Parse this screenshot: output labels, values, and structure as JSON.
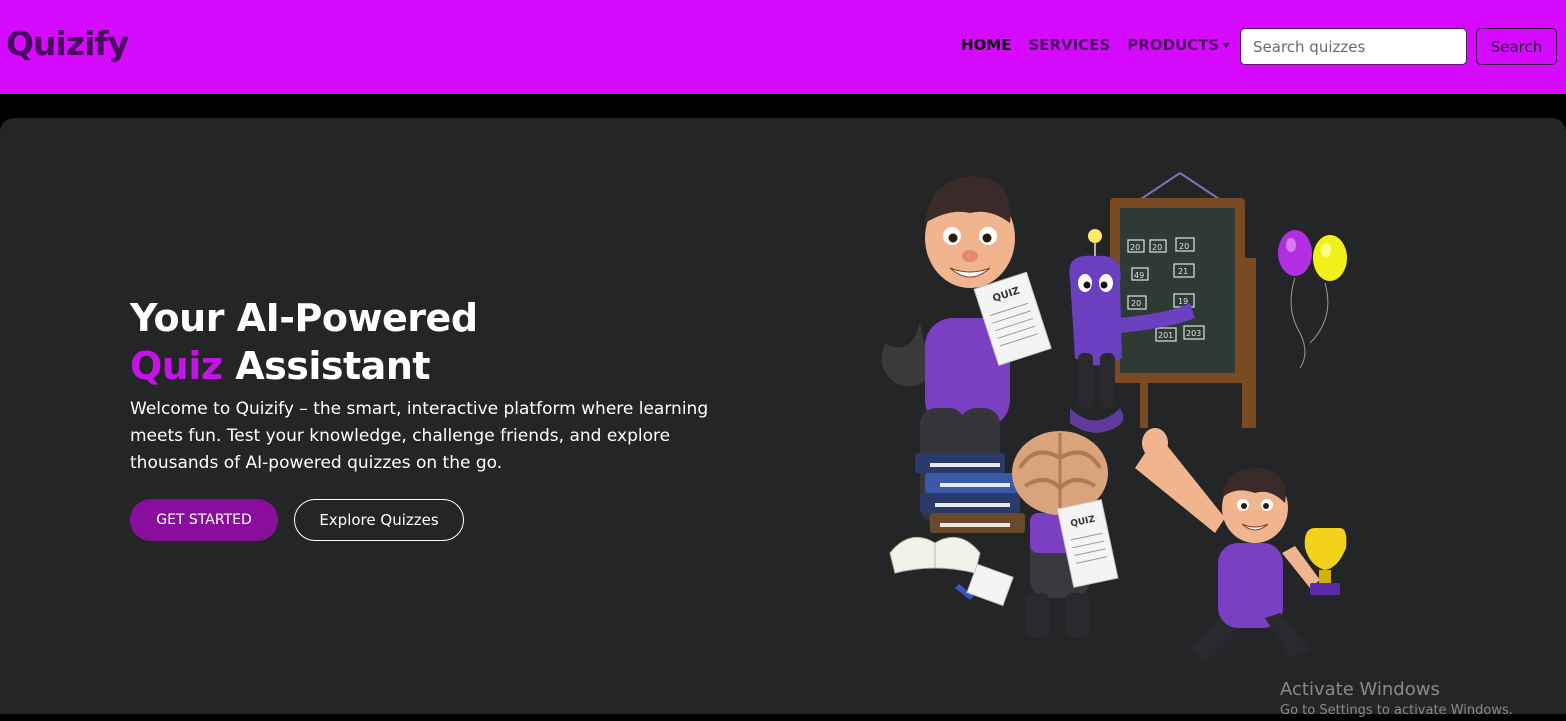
{
  "navbar": {
    "brand": "Quizify",
    "links": [
      {
        "label": "HOME",
        "active": true
      },
      {
        "label": "SERVICES",
        "active": false
      },
      {
        "label": "PRODUCTS",
        "active": false,
        "dropdown": true
      }
    ],
    "search": {
      "placeholder": "Search quizzes",
      "value": "",
      "button_label": "Search"
    }
  },
  "hero": {
    "headline_line1": "Your AI-Powered",
    "headline_accent": "Quiz",
    "headline_line2_rest": " Assistant",
    "description": "Welcome to Quizify – the smart, interactive platform where learning meets fun. Test your knowledge, challenge friends, and explore thousands of AI-powered quizzes on the go.",
    "primary_button": "GET STARTED",
    "secondary_button": "Explore Quizzes",
    "illustration": {
      "paper_label": "QUIZ",
      "board_numbers": [
        "20",
        "20",
        "20",
        "49",
        "21",
        "20",
        "19",
        "201",
        "203"
      ]
    }
  },
  "colors": {
    "nav_bg": "#d60aff",
    "hero_bg": "#242527",
    "accent": "#c413e6",
    "primary_button": "#8a0e9e"
  },
  "watermark": {
    "title": "Activate Windows",
    "subtitle": "Go to Settings to activate Windows."
  }
}
